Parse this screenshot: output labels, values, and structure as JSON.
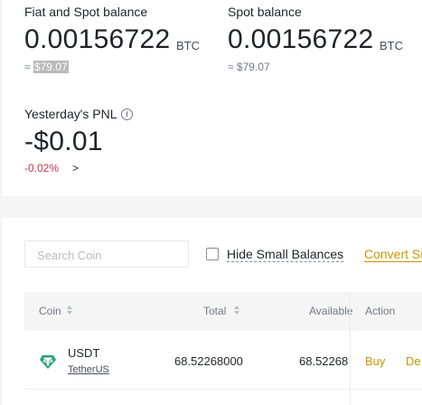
{
  "summary": {
    "fiat_spot": {
      "label": "Fiat and Spot balance",
      "value": "0.00156722",
      "unit": "BTC",
      "approx_prefix": "≈",
      "approx_value": "$79.07"
    },
    "spot": {
      "label": "Spot balance",
      "value": "0.00156722",
      "unit": "BTC",
      "approx": "≈ $79.07"
    },
    "pnl": {
      "label": "Yesterday's PNL",
      "info_glyph": "i",
      "value": "-$0.01",
      "percent": "-0.02%",
      "arrow": ">"
    }
  },
  "toolbar": {
    "search_placeholder": "Search Coin",
    "hide_small_label": "Hide Small Balances",
    "hide_small_checked": false,
    "convert_label": "Convert Sm"
  },
  "table": {
    "headers": {
      "coin": "Coin",
      "total": "Total",
      "available": "Available",
      "action": "Action"
    },
    "rows": [
      {
        "symbol": "USDT",
        "name": "TetherUS",
        "total": "68.52268000",
        "available": "68.52268",
        "actions": [
          "Buy",
          "De"
        ],
        "icon": "tether-icon"
      }
    ]
  },
  "colors": {
    "accent": "#c99400",
    "negative": "#cf304a",
    "tether": "#26a17b"
  }
}
